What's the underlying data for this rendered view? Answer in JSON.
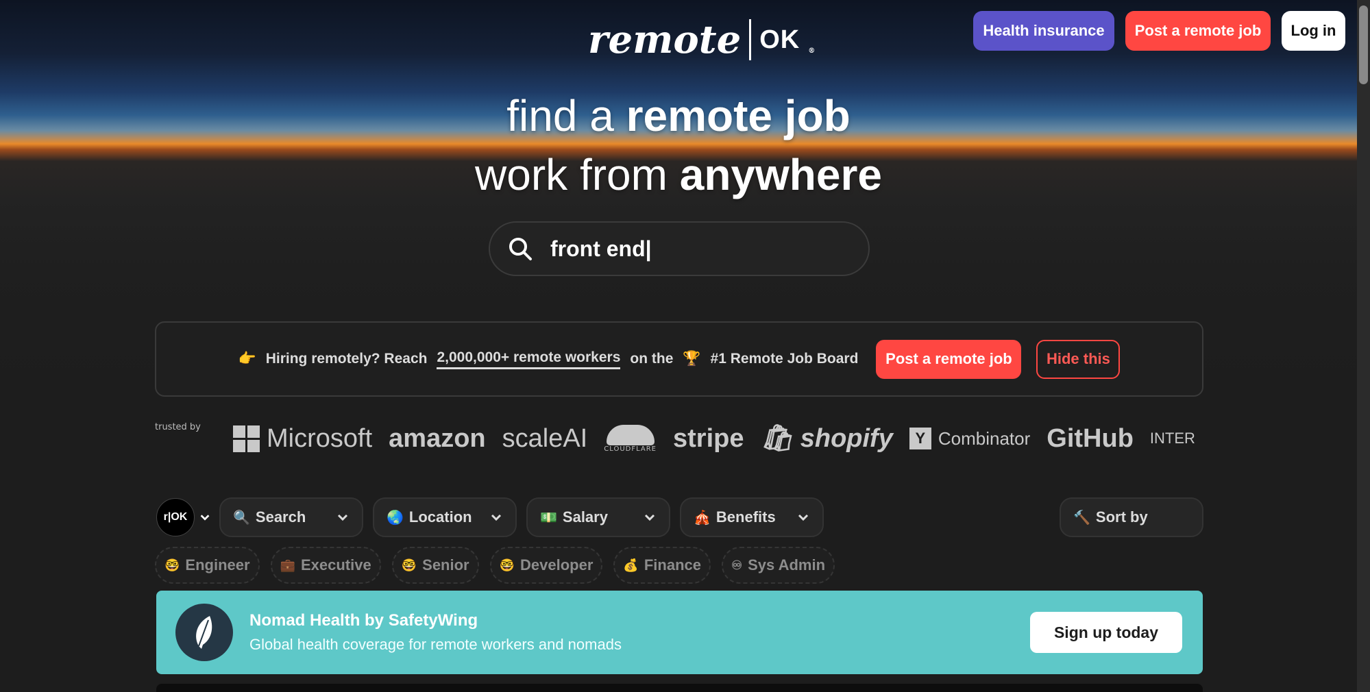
{
  "header": {
    "logo_text": "remote",
    "logo_ok": "OK",
    "logo_reg": "®",
    "nav": {
      "health_label": "Health insurance",
      "post_label": "Post a remote job",
      "login_label": "Log in"
    },
    "colors": {
      "health": "#5b53c9",
      "post": "#ff4742",
      "login": "#ffffff"
    }
  },
  "hero": {
    "line1_a": "find a ",
    "line1_b": "remote job",
    "line2_a": "work from ",
    "line2_b": "anywhere"
  },
  "search": {
    "icon": "search-icon",
    "value": "front end|"
  },
  "hiring_banner": {
    "emoji_point": "👉",
    "text_a": "Hiring remotely? Reach",
    "text_link": "2,000,000+ remote workers",
    "text_b": "on the",
    "emoji_trophy": "🏆",
    "text_c": "#1 Remote Job Board",
    "post_label": "Post a remote job",
    "hide_label": "Hide this"
  },
  "trusted": {
    "label": "trusted by",
    "brands": [
      "Microsoft",
      "amazon",
      "scaleAI",
      "CLOUDFLARE",
      "stripe",
      "shopify",
      "Combinator",
      "GitHub",
      "INTER"
    ],
    "yc_letter": "Y"
  },
  "filters": {
    "avatar_text": "r|OK",
    "items": [
      {
        "emoji": "🔍",
        "label": "Search"
      },
      {
        "emoji": "🌏",
        "label": "Location"
      },
      {
        "emoji": "💵",
        "label": "Salary"
      },
      {
        "emoji": "🎪",
        "label": "Benefits"
      }
    ],
    "sort": {
      "emoji": "🔨",
      "label": "Sort by"
    }
  },
  "tags": [
    {
      "emoji": "🤓",
      "label": "Engineer"
    },
    {
      "emoji": "💼",
      "label": "Executive"
    },
    {
      "emoji": "🤓",
      "label": "Senior"
    },
    {
      "emoji": "🤓",
      "label": "Developer"
    },
    {
      "emoji": "💰",
      "label": "Finance"
    },
    {
      "emoji": "♾",
      "label": "Sys Admin"
    }
  ],
  "nomad": {
    "title": "Nomad Health by SafetyWing",
    "subtitle": "Global health coverage for remote workers and nomads",
    "cta": "Sign up today",
    "bg_color": "#5ec8c8"
  }
}
